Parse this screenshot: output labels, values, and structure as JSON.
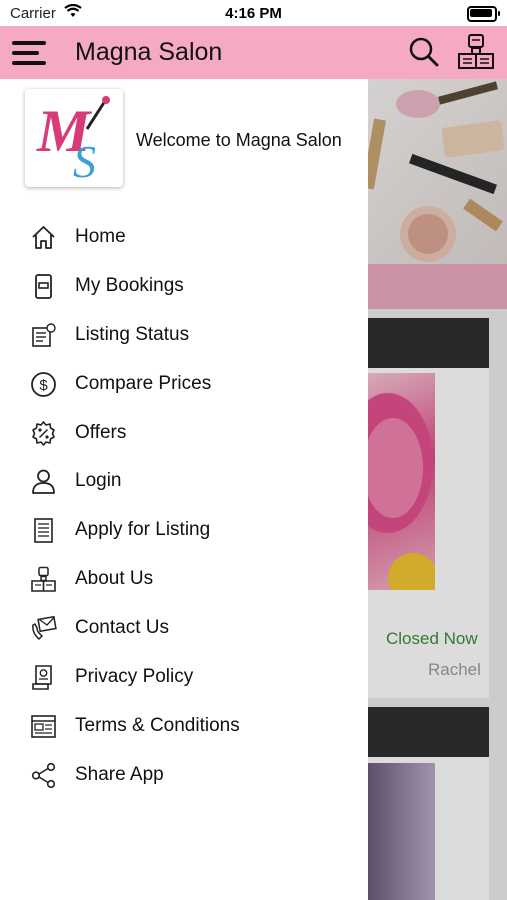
{
  "status_bar": {
    "carrier": "Carrier",
    "time": "4:16 PM"
  },
  "app_bar": {
    "title": "Magna Salon",
    "color": "#f5a9c2"
  },
  "drawer": {
    "welcome_text": "Welcome to Magna Salon",
    "logo_letters": "MS",
    "items": [
      {
        "label": "Home",
        "icon": "home-icon"
      },
      {
        "label": "My Bookings",
        "icon": "bookings-icon"
      },
      {
        "label": "Listing Status",
        "icon": "listing-status-icon"
      },
      {
        "label": "Compare Prices",
        "icon": "dollar-circle-icon"
      },
      {
        "label": "Offers",
        "icon": "percent-badge-icon"
      },
      {
        "label": "Login",
        "icon": "user-icon"
      },
      {
        "label": "Apply for Listing",
        "icon": "document-icon"
      },
      {
        "label": "About Us",
        "icon": "about-icon"
      },
      {
        "label": "Contact Us",
        "icon": "envelope-phone-icon"
      },
      {
        "label": "Privacy Policy",
        "icon": "privacy-document-icon"
      },
      {
        "label": "Terms & Conditions",
        "icon": "terms-icon"
      },
      {
        "label": "Share App",
        "icon": "share-icon"
      }
    ]
  },
  "background_listing": {
    "status_text": "Closed Now",
    "status_color": "#3a8a3a",
    "owner_name": "Rachel"
  }
}
